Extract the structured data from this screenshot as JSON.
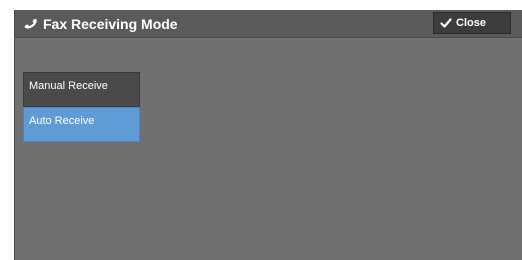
{
  "header": {
    "title": "Fax Receiving Mode",
    "title_icon": "phone-handset-icon",
    "close_label": "Close",
    "close_icon": "checkmark-icon"
  },
  "options": [
    {
      "label": "Manual Receive",
      "selected": false
    },
    {
      "label": "Auto Receive",
      "selected": true
    }
  ],
  "colors": {
    "panel_bg": "#707070",
    "header_bg": "#5a5a5a",
    "selected": "#5f9bd4",
    "unselected": "#4a4a4a",
    "close_bg": "#3c3c3c"
  }
}
